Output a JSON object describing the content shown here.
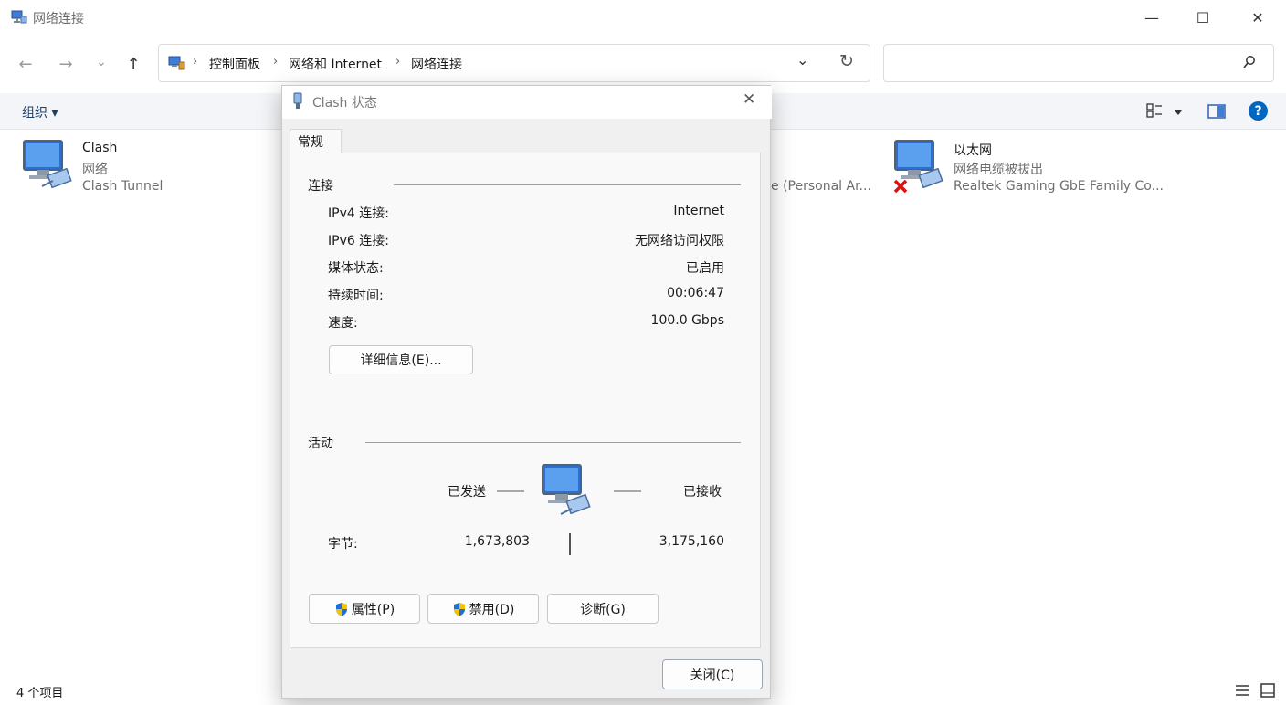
{
  "window": {
    "title": "网络连接",
    "minimize_glyph": "—",
    "maximize_glyph": "☐",
    "close_glyph": "✕"
  },
  "nav": {
    "back_icon": "←",
    "forward_icon": "→",
    "recent_icon": "⌄",
    "up_icon": "↑",
    "breadcrumbs": [
      "控制面板",
      "网络和 Internet",
      "网络连接"
    ],
    "breadcrumb_sep": "›",
    "dropdown_icon": "⌄",
    "refresh_icon": "↻",
    "search_icon": "⚲"
  },
  "toolbar": {
    "organize_label": "组织 ▾",
    "help_glyph": "?"
  },
  "items": [
    {
      "name": "Clash",
      "type": "网络",
      "device": "Clash Tunnel"
    },
    {
      "name": "",
      "type": "",
      "device": "e (Personal Ar..."
    },
    {
      "name": "以太网",
      "type": "网络电缆被拔出",
      "device": "Realtek Gaming GbE Family Co..."
    }
  ],
  "status_bar": {
    "count_label": "4 个项目"
  },
  "dialog": {
    "title": "Clash 状态",
    "tab_label": "常规",
    "connection": {
      "group_label": "连接",
      "rows": [
        {
          "label": "IPv4 连接:",
          "value": "Internet"
        },
        {
          "label": "IPv6 连接:",
          "value": "无网络访问权限"
        },
        {
          "label": "媒体状态:",
          "value": "已启用"
        },
        {
          "label": "持续时间:",
          "value": "00:06:47"
        },
        {
          "label": "速度:",
          "value": "100.0 Gbps"
        }
      ],
      "details_button": "详细信息(E)..."
    },
    "activity": {
      "group_label": "活动",
      "sent_label": "已发送",
      "received_label": "已接收",
      "bytes_label": "字节:",
      "bytes_sent": "1,673,803",
      "bytes_received": "3,175,160"
    },
    "buttons": {
      "properties": "属性(P)",
      "disable": "禁用(D)",
      "diagnose": "诊断(G)",
      "close": "关闭(C)"
    }
  },
  "colors": {
    "accent": "#0067c0",
    "cmdbar_bg": "#f3f5f8",
    "dialog_bg": "#f0f0f0"
  }
}
